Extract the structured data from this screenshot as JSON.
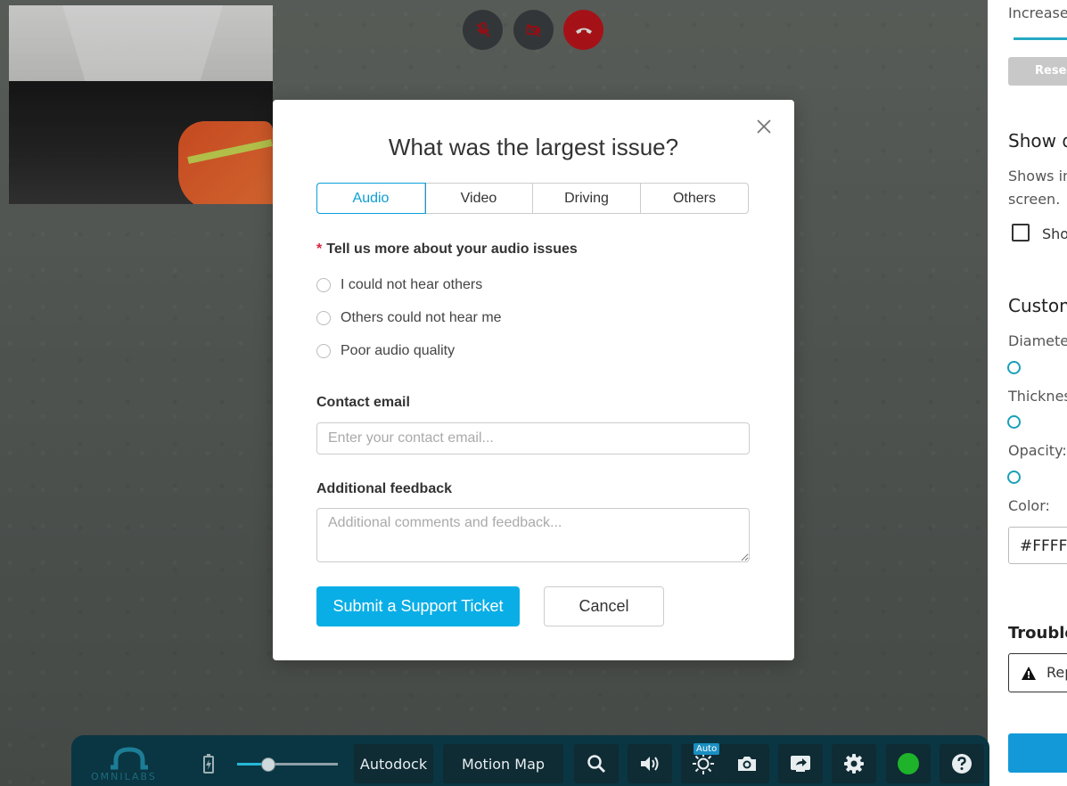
{
  "modal": {
    "title": "What was the largest issue?",
    "tabs": [
      "Audio",
      "Video",
      "Driving",
      "Others"
    ],
    "active_tab": "Audio",
    "question": "Tell us more about your audio issues",
    "required_marker": "*",
    "options": [
      "I could not hear others",
      "Others could not hear me",
      "Poor audio quality"
    ],
    "email_label": "Contact email",
    "email_placeholder": "Enter your contact email...",
    "feedback_label": "Additional feedback",
    "feedback_placeholder": "Additional comments and feedback...",
    "submit_label": "Submit a Support Ticket",
    "cancel_label": "Cancel"
  },
  "right_panel": {
    "increase_label": "Increase",
    "reset_label": "Rese",
    "show_heading": "Show d",
    "show_desc_line1": "Shows in",
    "show_desc_line2": "screen.",
    "show_checkbox_label": "Sho",
    "custom_heading": "Custom",
    "diameter_label": "Diameter",
    "thickness_label": "Thickness",
    "opacity_label": "Opacity:",
    "color_label": "Color:",
    "color_value": "#FFFFF",
    "trouble_heading": "Trouble",
    "report_label": "Rep"
  },
  "toolbar": {
    "logo_text": "OMNILABS",
    "autodock_label": "Autodock",
    "motion_map_label": "Motion Map",
    "auto_badge": "Auto",
    "volume_fraction": 0.3
  },
  "colors": {
    "accent": "#0aaee6",
    "toolbar_bg": "#093642",
    "hangup_red": "#c8161d",
    "status_green": "#1eb32a",
    "required_red": "#e0203a"
  }
}
